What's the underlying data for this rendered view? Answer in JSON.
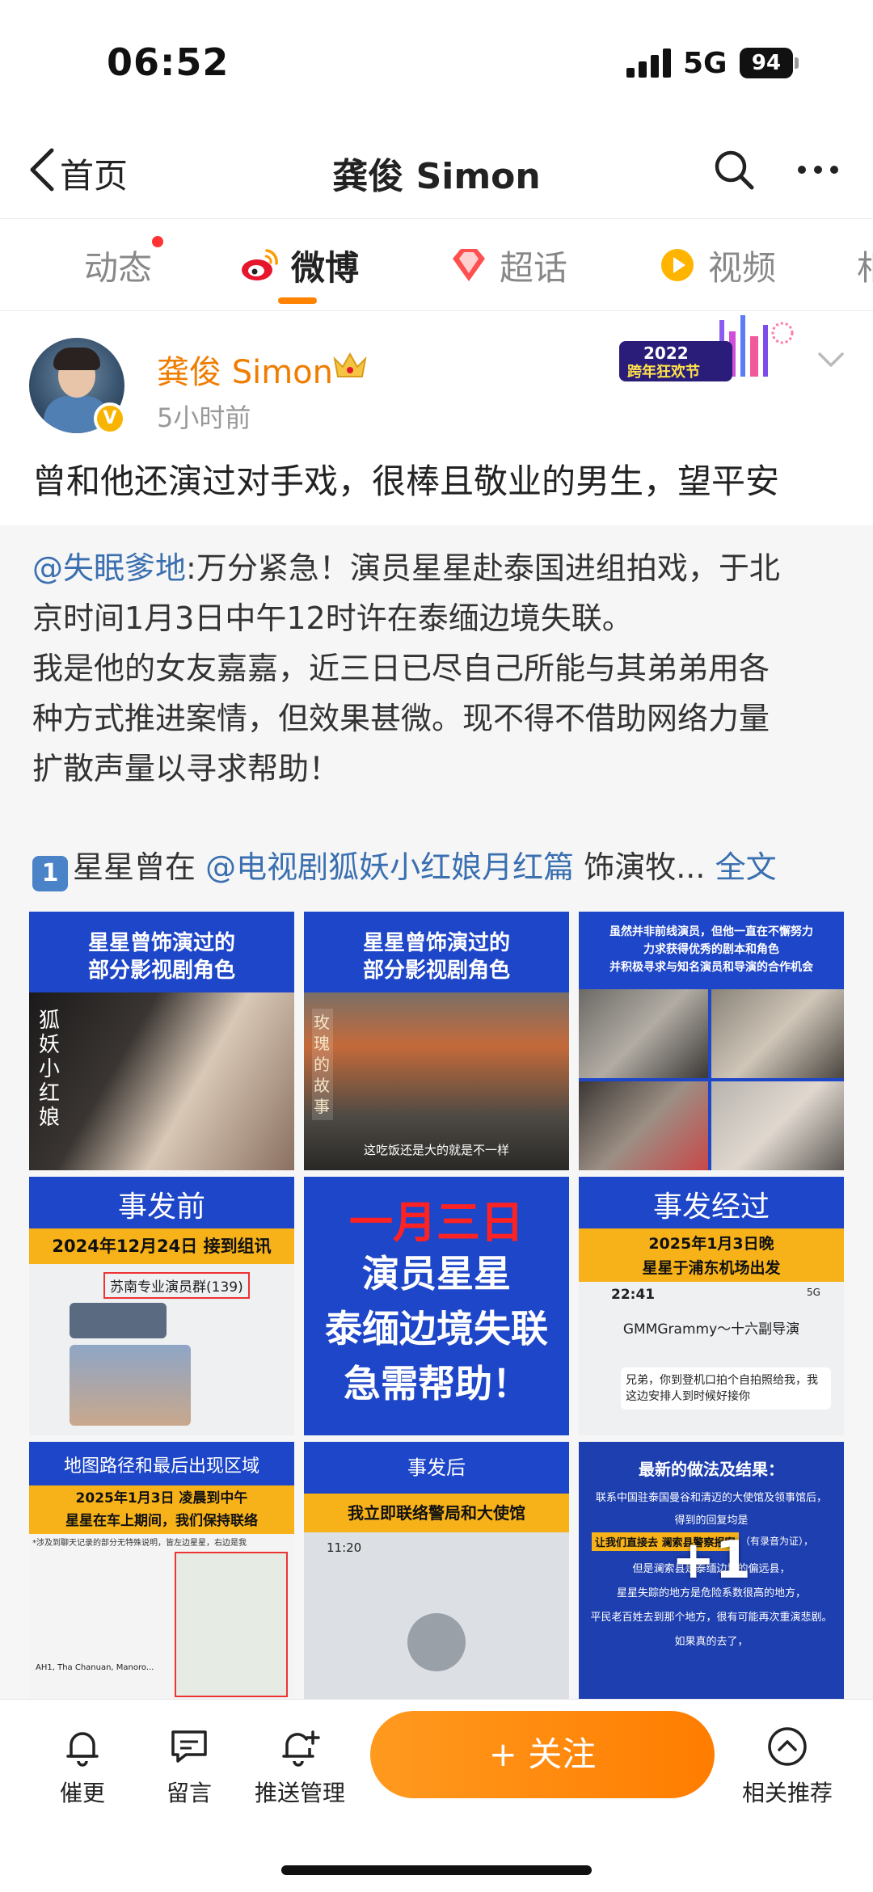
{
  "status_bar": {
    "time": "06:52",
    "network": "5G",
    "battery": "94"
  },
  "header": {
    "back_label": "首页",
    "title": "龚俊 Simon"
  },
  "tabs": [
    {
      "label": "动态"
    },
    {
      "label": "微博"
    },
    {
      "label": "超话"
    },
    {
      "label": "视频"
    },
    {
      "label": "相"
    }
  ],
  "post": {
    "username": "龚俊 Simon",
    "time": "5小时前",
    "banner_year": "2022",
    "banner_text": "跨年狂欢节",
    "text": "曾和他还演过对手戏，很棒且敬业的男生，望平安"
  },
  "repost": {
    "mention": "@失眠爹地",
    "line1": ":万分紧急！演员星星赴泰国进组拍戏，于北",
    "line2": "京时间1月3日中午12时许在泰缅边境失联。",
    "line3": "我是他的女友嘉嘉，近三日已尽自己所能与其弟弟用各",
    "line4": "种方式推进案情，但效果甚微。现不得不借助网络力量",
    "line5": "扩散声量以寻求帮助！",
    "keycap": "1",
    "line6_pre": "星星曾在",
    "line6_mention": "@电视剧狐妖小红娘月红篇",
    "line6_post": "饰演牧...",
    "full_text_link": "全文"
  },
  "images": [
    {
      "title": "星星曾饰演过的\n部分影视剧角色",
      "overlay": "狐妖小红娘"
    },
    {
      "title": "星星曾饰演过的\n部分影视剧角色",
      "overlay": "玫瑰的故事",
      "caption": "这吃饭还是大的就是不一样"
    },
    {
      "title": "虽然并非前线演员，但他一直在不懈努力\n力求获得优秀的剧本和角色\n并积极寻求与知名演员和导演的合作机会"
    },
    {
      "title": "事发前",
      "bar": "2024年12月24日 接到组讯",
      "chat_title": "苏南专业演员群(139)"
    },
    {
      "date": "一月三日",
      "l1": "演员星星",
      "l2": "泰缅边境失联",
      "l3": "急需帮助！"
    },
    {
      "title": "事发经过",
      "bar": "2025年1月3日晚\n星星于浦东机场出发",
      "phone_time": "22:41",
      "phone_net": "5G",
      "chat_name": "GMMGrammy～十六副导演",
      "chat_msg": "兄弟，你到登机口拍个自拍照给我，我这边安排人到时候好接你"
    },
    {
      "title": "地图路径和最后出现区域",
      "bar": "2025年1月3日 凌晨到中午\n星星在车上期间，我们保持联络",
      "note": "*涉及到聊天记录的部分无特殊说明，皆左边星星，右边是我",
      "map_label": "AH1, Tha Chanuan, Manoro..."
    },
    {
      "title": "事发后",
      "bar": "我立即联络警局和大使馆",
      "phone_time": "11:20"
    },
    {
      "title": "最新的做法及结果：",
      "body1": "联系中国驻泰国曼谷和清迈的大使馆及领事馆后，",
      "body2": "得到的回复均是",
      "highlight": "让我们直接去 澜索县警察报案",
      "body3": "（有录音为证），",
      "body4": "但是澜索县是泰缅边境的偏远县，",
      "body5": "星星失踪的地方是危险系数很高的地方，",
      "body6": "平民老百姓去到那个地方，很有可能再次重演悲剧。",
      "body7": "如果真的去了，",
      "more": "+1"
    }
  ],
  "bottom_bar": {
    "items": [
      {
        "label": "催更",
        "icon": "bell-icon"
      },
      {
        "label": "留言",
        "icon": "message-icon"
      },
      {
        "label": "推送管理",
        "icon": "bell-plus-icon"
      },
      {
        "label": "相关推荐",
        "icon": "chevron-up-circle-icon"
      }
    ],
    "follow_label": "+ 关注"
  },
  "colors": {
    "accent": "#ff8200",
    "link": "#3a6fb0",
    "username": "#f07c00",
    "image_blue": "#1e46c8"
  }
}
